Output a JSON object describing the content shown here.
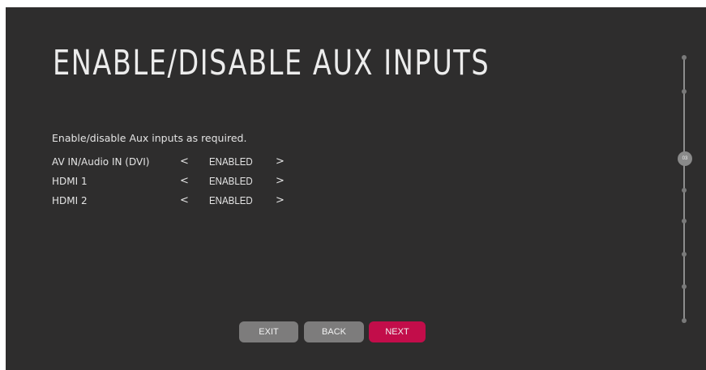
{
  "page": {
    "title": "ENABLE/DISABLE AUX INPUTS",
    "description": "Enable/disable Aux inputs as required."
  },
  "inputs": [
    {
      "label": "AV IN/Audio IN (DVI)",
      "value": "ENABLED",
      "prev_icon": "<",
      "next_icon": ">"
    },
    {
      "label": "HDMI 1",
      "value": "ENABLED",
      "prev_icon": "<",
      "next_icon": ">"
    },
    {
      "label": "HDMI 2",
      "value": "ENABLED",
      "prev_icon": "<",
      "next_icon": ">"
    }
  ],
  "buttons": {
    "exit": "EXIT",
    "back": "BACK",
    "next": "NEXT"
  },
  "stepper": {
    "current_step": "03"
  },
  "colors": {
    "background": "#2e2d2d",
    "button_gray": "#7d7c7c",
    "button_accent": "#c20d4a"
  }
}
